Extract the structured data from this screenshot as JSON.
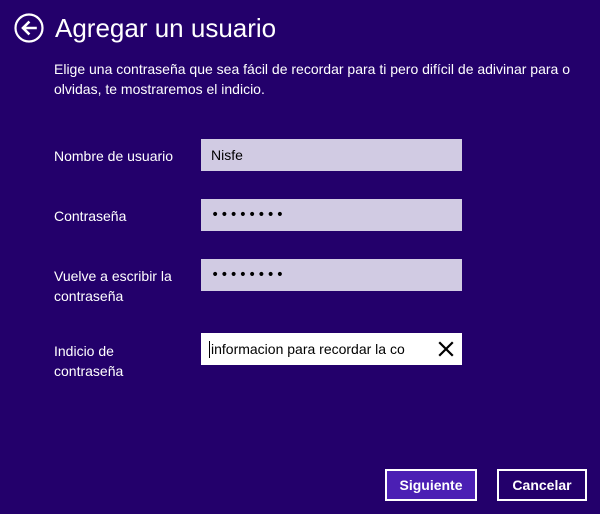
{
  "header": {
    "title": "Agregar un usuario",
    "back_icon": "back-arrow-icon"
  },
  "description": {
    "line1": "Elige una contraseña que sea fácil de recordar para ti pero difícil de adivinar para o",
    "line2": "olvidas, te mostraremos el indicio."
  },
  "form": {
    "username": {
      "label": "Nombre de usuario",
      "value": "Nisfe"
    },
    "password": {
      "label": "Contraseña",
      "value": "••••••••"
    },
    "confirm_password": {
      "label_line1": "Vuelve a escribir la",
      "label_line2": "contraseña",
      "value": "••••••••"
    },
    "hint": {
      "label_line1": "Indicio de",
      "label_line2": "contraseña",
      "value": "informacion para recordar la co",
      "clear_icon": "close-icon"
    }
  },
  "buttons": {
    "next_label": "Siguiente",
    "cancel_label": "Cancelar"
  },
  "colors": {
    "background": "#23006b",
    "input_background": "#d1cbe3",
    "primary_button": "#4b1fb4",
    "text": "#ffffff"
  }
}
